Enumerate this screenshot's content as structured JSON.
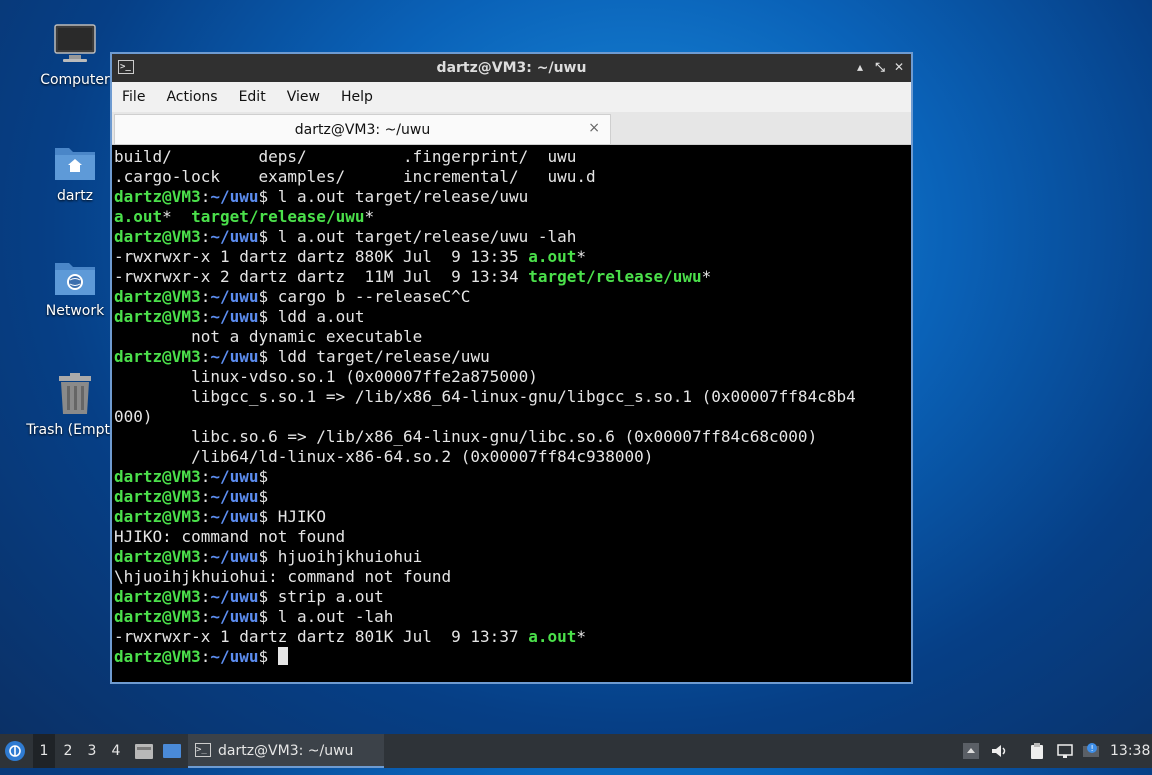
{
  "desktop": {
    "icons": [
      {
        "label": "Computer",
        "icon": "monitor-icon"
      },
      {
        "label": "dartz",
        "icon": "home-folder-icon"
      },
      {
        "label": "Network",
        "icon": "network-folder-icon"
      },
      {
        "label": "Trash (Empty)",
        "icon": "trash-icon"
      }
    ]
  },
  "window": {
    "title": "dartz@VM3: ~/uwu",
    "menu": [
      "File",
      "Actions",
      "Edit",
      "View",
      "Help"
    ],
    "tab": {
      "label": "dartz@VM3: ~/uwu",
      "close": "×"
    },
    "controls": {
      "minimize": "▴",
      "maximize": "⤡",
      "close": "✕"
    }
  },
  "terminal": {
    "prompt_user": "dartz@VM3",
    "prompt_sep": ":",
    "prompt_path": "~/uwu",
    "prompt_end": "$ ",
    "lines": [
      [
        {
          "t": "build/         deps/          .fingerprint/  uwu"
        }
      ],
      [
        {
          "t": ".cargo-lock    examples/      incremental/   uwu.d"
        }
      ],
      [
        {
          "p": true
        },
        {
          "t": "l a.out target/release/uwu"
        }
      ],
      [
        {
          "t": "a.out",
          "c": "g"
        },
        {
          "t": "*  "
        },
        {
          "t": "target/release/uwu",
          "c": "g"
        },
        {
          "t": "*"
        }
      ],
      [
        {
          "p": true
        },
        {
          "t": "l a.out target/release/uwu -lah"
        }
      ],
      [
        {
          "t": "-rwxrwxr-x 1 dartz dartz 880K Jul  9 13:35 "
        },
        {
          "t": "a.out",
          "c": "g"
        },
        {
          "t": "*"
        }
      ],
      [
        {
          "t": "-rwxrwxr-x 2 dartz dartz  11M Jul  9 13:34 "
        },
        {
          "t": "target/release/uwu",
          "c": "g"
        },
        {
          "t": "*"
        }
      ],
      [
        {
          "p": true
        },
        {
          "t": "cargo b --releaseC^C"
        }
      ],
      [
        {
          "p": true
        },
        {
          "t": "ldd a.out"
        }
      ],
      [
        {
          "t": "        not a dynamic executable"
        }
      ],
      [
        {
          "p": true
        },
        {
          "t": "ldd target/release/uwu"
        }
      ],
      [
        {
          "t": "        linux-vdso.so.1 (0x00007ffe2a875000)"
        }
      ],
      [
        {
          "t": "        libgcc_s.so.1 => /lib/x86_64-linux-gnu/libgcc_s.so.1 (0x00007ff84c8b4"
        }
      ],
      [
        {
          "t": "000)"
        }
      ],
      [
        {
          "t": "        libc.so.6 => /lib/x86_64-linux-gnu/libc.so.6 (0x00007ff84c68c000)"
        }
      ],
      [
        {
          "t": "        /lib64/ld-linux-x86-64.so.2 (0x00007ff84c938000)"
        }
      ],
      [
        {
          "p": true
        }
      ],
      [
        {
          "p": true
        }
      ],
      [
        {
          "p": true
        },
        {
          "t": "HJIKO"
        }
      ],
      [
        {
          "t": "HJIKO: command not found"
        }
      ],
      [
        {
          "p": true
        },
        {
          "t": "hjuoihjkhuiohui"
        }
      ],
      [
        {
          "t": "\\hjuoihjkhuiohui: command not found"
        }
      ],
      [
        {
          "p": true
        },
        {
          "t": "strip a.out"
        }
      ],
      [
        {
          "p": true
        },
        {
          "t": "l a.out -lah"
        }
      ],
      [
        {
          "t": "-rwxrwxr-x 1 dartz dartz 801K Jul  9 13:37 "
        },
        {
          "t": "a.out",
          "c": "g"
        },
        {
          "t": "*"
        }
      ],
      [
        {
          "p": true
        },
        {
          "cursor": true
        }
      ]
    ]
  },
  "taskbar": {
    "workspaces": [
      "1",
      "2",
      "3",
      "4"
    ],
    "active_workspace": "1",
    "task": "dartz@VM3: ~/uwu",
    "clock": "13:38",
    "colors": {
      "prompt": "#4be04b",
      "path": "#5c8df0",
      "accent": "#6e9bd1"
    }
  }
}
